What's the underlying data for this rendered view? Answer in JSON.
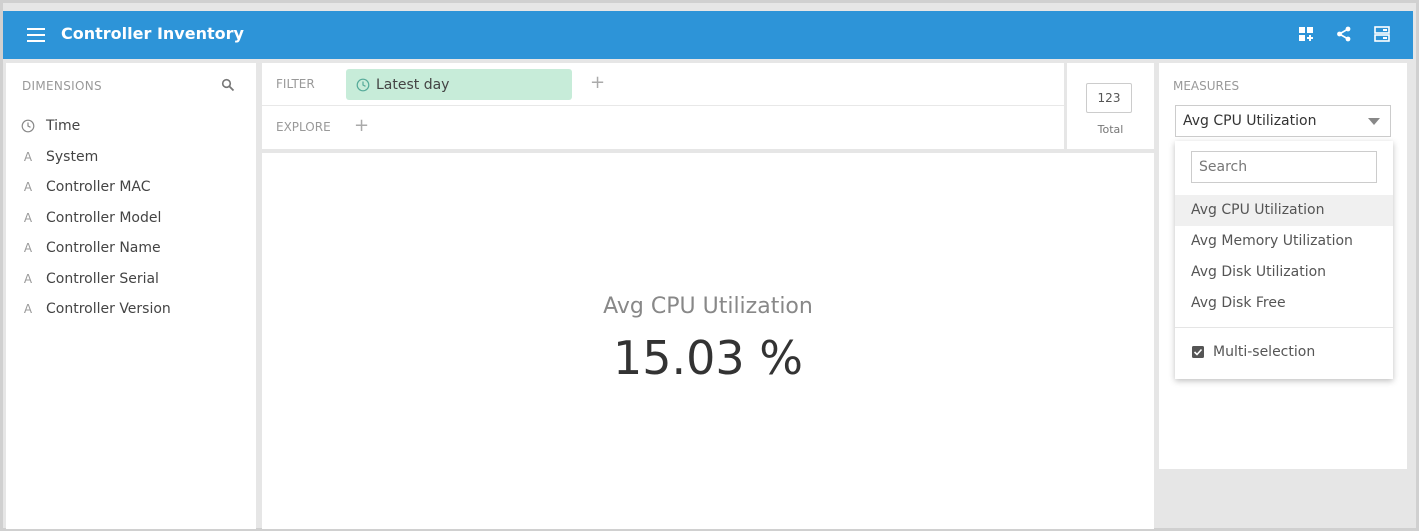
{
  "header": {
    "title": "Controller Inventory",
    "icons": [
      "dashboard-add-icon",
      "share-icon",
      "layout-icon"
    ]
  },
  "dimensions": {
    "title": "DIMENSIONS",
    "items": [
      {
        "label": "Time",
        "icon": "clock-icon"
      },
      {
        "label": "System",
        "icon": "text-type-icon"
      },
      {
        "label": "Controller MAC",
        "icon": "text-type-icon"
      },
      {
        "label": "Controller Model",
        "icon": "text-type-icon"
      },
      {
        "label": "Controller Name",
        "icon": "text-type-icon"
      },
      {
        "label": "Controller Serial",
        "icon": "text-type-icon"
      },
      {
        "label": "Controller Version",
        "icon": "text-type-icon"
      }
    ]
  },
  "filter": {
    "label": "FILTER",
    "pill": "Latest day",
    "add": "+"
  },
  "explore": {
    "label": "EXPLORE",
    "add": "+"
  },
  "total": {
    "count": "123",
    "label": "Total"
  },
  "viz": {
    "title": "Avg CPU Utilization",
    "value": "15.03 %"
  },
  "measures": {
    "title": "MEASURES",
    "selected": "Avg CPU Utilization",
    "search_placeholder": "Search",
    "options": [
      "Avg CPU Utilization",
      "Avg Memory Utilization",
      "Avg Disk Utilization",
      "Avg Disk Free"
    ],
    "multi_selection": "Multi-selection"
  },
  "colors": {
    "header_bg": "#2d94d8",
    "filter_pill_bg": "#c7ecd9"
  }
}
